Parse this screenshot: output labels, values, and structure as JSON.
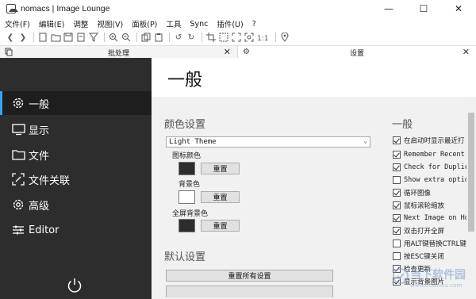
{
  "window": {
    "title": "nomacs | Image Lounge",
    "minimize": "—",
    "maximize": "☐",
    "close": "✕"
  },
  "menu": [
    "文件(F)",
    "编辑(E)",
    "调整",
    "视图(V)",
    "面板(P)",
    "工具",
    "Sync",
    "插件(U)",
    "?"
  ],
  "tabs": {
    "left": "批处理",
    "right": "设置"
  },
  "nav": {
    "items": [
      {
        "label": "一般",
        "icon": "gear-icon",
        "active": true
      },
      {
        "label": "显示",
        "icon": "monitor-icon"
      },
      {
        "label": "文件",
        "icon": "folder-icon"
      },
      {
        "label": "文件关联",
        "icon": "link-icon"
      },
      {
        "label": "高级",
        "icon": "gear-icon"
      },
      {
        "label": "Editor",
        "icon": "sliders-icon"
      }
    ],
    "power_icon": "power-icon"
  },
  "panel": {
    "title": "一般",
    "color_settings": {
      "title": "颜色设置",
      "theme": "Light Theme",
      "icon_color_label": "图标颜色",
      "icon_color": "#2d2d2d",
      "bg_color_label": "背景色",
      "bg_color": "#ffffff",
      "fullscreen_bg_label": "全屏背景色",
      "fullscreen_bg_color": "#2d2d2d",
      "reset_label": "重置"
    },
    "defaults": {
      "title": "默认设置",
      "reset_all": "重置所有设置"
    },
    "general": {
      "title": "一般",
      "checkboxes": [
        {
          "label": "在启动时显示最近打",
          "checked": true
        },
        {
          "label": "Remember Recent",
          "checked": true
        },
        {
          "label": "Check for Duplic",
          "checked": true
        },
        {
          "label": "Show extra optio",
          "checked": false
        },
        {
          "label": "循环图像",
          "checked": true
        },
        {
          "label": "鼠标滚轮缩放",
          "checked": true
        },
        {
          "label": "Next Image on Ho",
          "checked": true
        },
        {
          "label": "双击打开全屏",
          "checked": true
        },
        {
          "label": "用ALT键替换CTRL键",
          "checked": false
        },
        {
          "label": "按ESC键关闭",
          "checked": false
        },
        {
          "label": "检查更新",
          "checked": true
        },
        {
          "label": "显示背景图片",
          "checked": true
        }
      ]
    }
  },
  "watermark": {
    "text": "当下软件园",
    "sub": "www.downxia.com"
  }
}
